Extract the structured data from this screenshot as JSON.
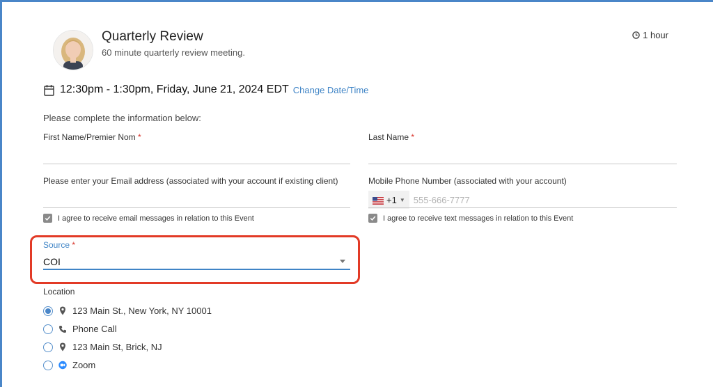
{
  "header": {
    "title": "Quarterly Review",
    "subtitle": "60 minute quarterly review meeting.",
    "duration": "1 hour"
  },
  "appointment": {
    "datetime": "12:30pm - 1:30pm, Friday, June 21, 2024 EDT",
    "change_link": "Change Date/Time"
  },
  "form": {
    "intro": "Please complete the information below:",
    "required_mark": "*",
    "first_name_label": "First Name/Premier Nom",
    "last_name_label": "Last Name",
    "email_label": "Please enter your Email address (associated with your account if existing client)",
    "phone_label": "Mobile Phone Number (associated with your account)",
    "phone_country_code": "+1",
    "phone_placeholder": "555-666-7777",
    "email_consent": "I agree to receive email messages in relation to this Event",
    "text_consent": "I agree to receive text messages in relation to this Event",
    "source_label": "Source",
    "source_value": "COI",
    "location_label": "Location",
    "locations": [
      {
        "label": "123 Main St., New York, NY 10001",
        "icon": "map-pin-icon",
        "checked": true
      },
      {
        "label": "Phone Call",
        "icon": "phone-icon",
        "checked": false
      },
      {
        "label": "123 Main St, Brick, NJ",
        "icon": "map-pin-icon",
        "checked": false
      },
      {
        "label": "Zoom",
        "icon": "zoom-icon",
        "checked": false
      }
    ]
  },
  "colors": {
    "accent": "#3f84c6",
    "required": "#d9342b",
    "highlight": "#e23a26"
  }
}
